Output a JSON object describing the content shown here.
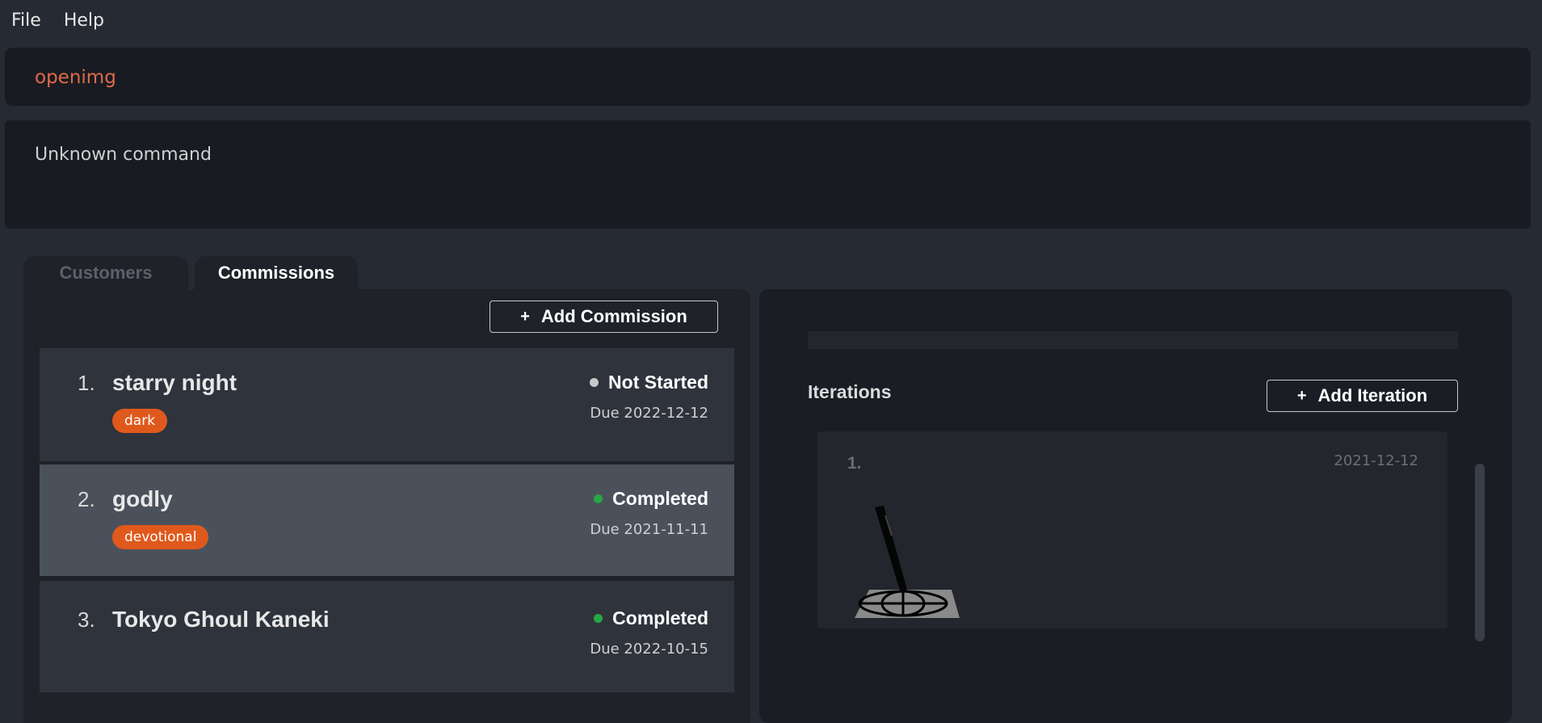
{
  "menu": {
    "file": "File",
    "help": "Help"
  },
  "command": {
    "text": "openimg"
  },
  "result": {
    "text": "Unknown command"
  },
  "tabs": [
    {
      "label": "Customers",
      "active": false
    },
    {
      "label": "Commissions",
      "active": true
    }
  ],
  "commissions": {
    "add_button": {
      "icon": "+",
      "label": "Add Commission"
    },
    "items": [
      {
        "index": "1.",
        "name": "starry night",
        "tag": "dark",
        "status": "Not Started",
        "status_color": "#c8c8c8",
        "due": "Due 2022-12-12"
      },
      {
        "index": "2.",
        "name": "godly",
        "tag": "devotional",
        "status": "Completed",
        "status_color": "#28a745",
        "due": "Due 2021-11-11"
      },
      {
        "index": "3.",
        "name": "Tokyo Ghoul Kaneki",
        "tag": "",
        "status": "Completed",
        "status_color": "#28a745",
        "due": "Due 2022-10-15"
      }
    ]
  },
  "iterations": {
    "title": "Iterations",
    "add_button": {
      "icon": "+",
      "label": "Add Iteration"
    },
    "items": [
      {
        "index": "1.",
        "date": "2021-12-12",
        "image": "pen-on-globe-drawing"
      }
    ]
  },
  "colors": {
    "accent_command": "#e06a4a",
    "tag_bg": "#e0591c",
    "completed": "#28a745",
    "not_started": "#c8c8c8"
  }
}
